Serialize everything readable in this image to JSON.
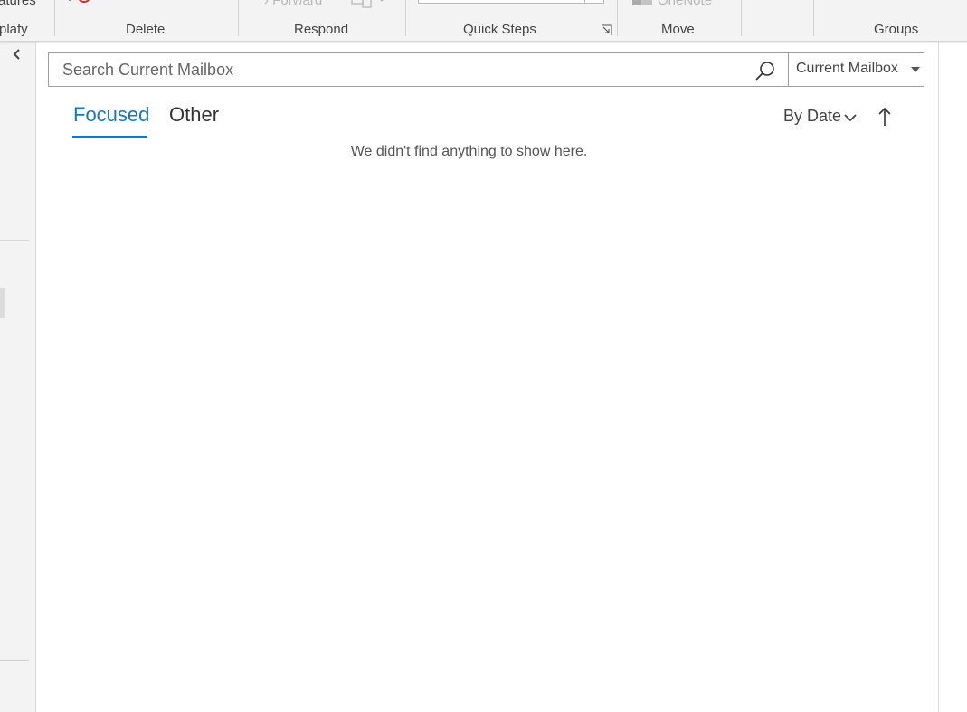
{
  "ribbon": {
    "partial_top_text": "atures",
    "partial_group_label": "plafy",
    "groups": {
      "delete": "Delete",
      "respond": "Respond",
      "quick_steps": "Quick Steps",
      "move": "Move",
      "groups": "Groups"
    },
    "faded_items": {
      "forward": "› Forward",
      "onenote": "OneNote"
    }
  },
  "search": {
    "placeholder": "Search Current Mailbox",
    "value": "",
    "scope": "Current Mailbox"
  },
  "tabs": {
    "focused": "Focused",
    "other": "Other",
    "active": "focused"
  },
  "sort": {
    "label": "By Date",
    "direction": "ascending"
  },
  "message_list": {
    "empty_text": "We didn't find anything to show here."
  },
  "colors": {
    "accent": "#1a74c4",
    "delete_red": "#d13438"
  },
  "icons": [
    "collapse-chevron-left-icon",
    "search-icon",
    "dropdown-caret-icon",
    "chevron-down-icon",
    "sort-arrow-up-icon",
    "dialog-launcher-icon"
  ]
}
